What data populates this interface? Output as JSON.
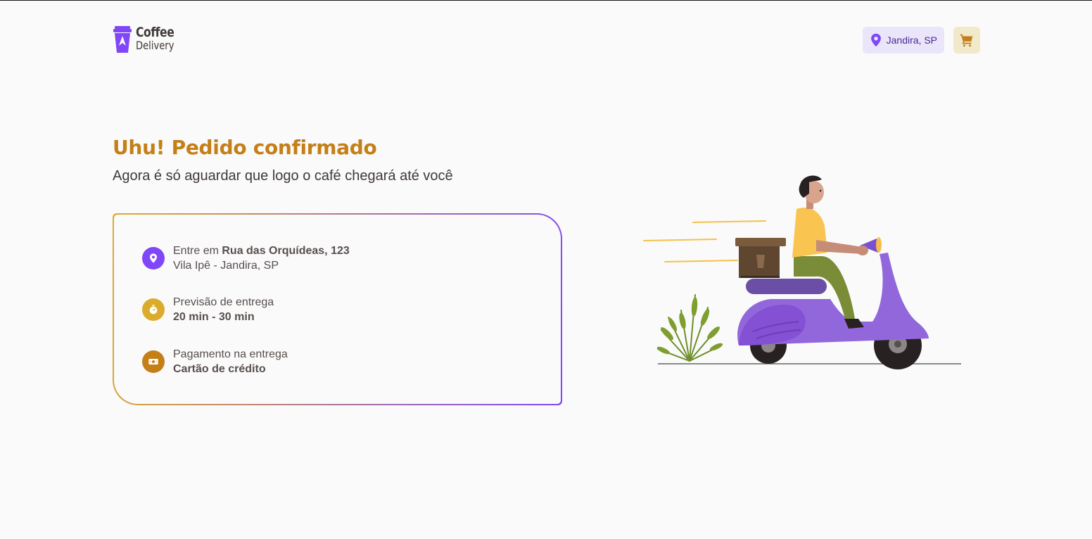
{
  "header": {
    "logo": {
      "line1": "Coffee",
      "line2": "Delivery"
    },
    "location": {
      "label": "Jandira, SP",
      "icon": "map-pin-icon"
    },
    "cart": {
      "icon": "shopping-cart-icon"
    }
  },
  "main": {
    "title": "Uhu! Pedido confirmado",
    "subtitle": "Agora é só aguardar que logo o café chegará até você"
  },
  "order_info": {
    "address": {
      "icon": "map-pin-icon",
      "prefix": "Entre em ",
      "street": "Rua das Orquídeas, 123",
      "district": "Vila Ipê - Jandira, SP"
    },
    "delivery": {
      "icon": "timer-icon",
      "label": "Previsão de entrega",
      "value": "20 min - 30 min"
    },
    "payment": {
      "icon": "currency-dollar-icon",
      "label": "Pagamento na entrega",
      "value": "Cartão de crédito"
    }
  },
  "colors": {
    "brand_yellow": "#C47F17",
    "brand_purple": "#8047F8",
    "yellow": "#DBAC2C",
    "purple_light": "#EBE5F9",
    "yellow_light": "#F1E9C9"
  },
  "illustration": {
    "name": "delivery-scooter-illustration"
  }
}
